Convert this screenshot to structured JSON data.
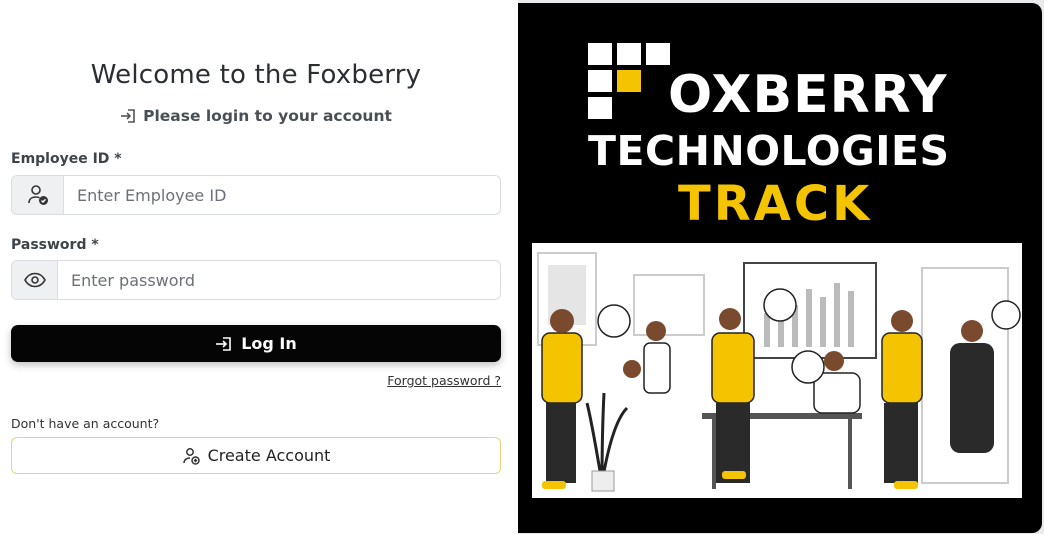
{
  "login": {
    "title": "Welcome to the Foxberry",
    "subtitle": "Please login to your account",
    "employee_id_label": "Employee ID *",
    "employee_id_placeholder": "Enter Employee ID",
    "password_label": "Password *",
    "password_placeholder": "Enter password",
    "login_button": "Log In",
    "forgot_password": "Forgot password ?",
    "no_account_text": "Don't have an account?",
    "create_account_button": "Create Account"
  },
  "brand": {
    "line1": "OXBERRY",
    "line2": "TECHNOLOGIES",
    "line3": "TRACK",
    "accent_color": "#f5c400"
  },
  "icons": {
    "subtitle": "login-icon",
    "employee": "user-check-icon",
    "password": "eye-icon",
    "login": "login-icon",
    "create": "user-add-icon"
  }
}
